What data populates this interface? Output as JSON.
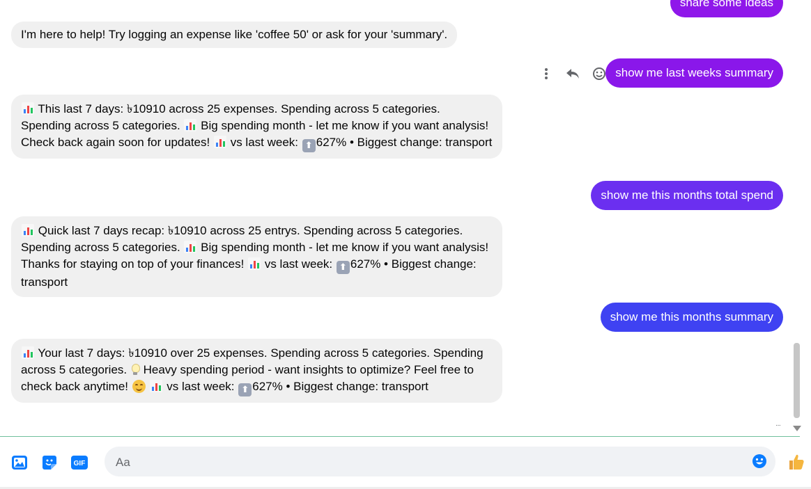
{
  "colors": {
    "bubble_out_1": "#8f17ea",
    "bubble_out_2": "#8a17ea",
    "bubble_out_3": "#6b2ff0",
    "bubble_out_4": "#3f42f2",
    "bubble_in": "#f0f0f0",
    "icon_blue": "#0a7cff"
  },
  "messages": {
    "out_0": "share some ideas",
    "in_0": "I'm here to help! Try logging an expense like 'coffee 50' or ask for your 'summary'.",
    "out_1": "show me last weeks summary",
    "in_1": {
      "a": "This last 7 days: ৳10910 across 25 expenses. Spending across 5 categories. Spending across 5 categories.",
      "b": "Big spending month - let me know if you want analysis! Check back again soon for updates!",
      "c": "vs last week:",
      "d": "627% • Biggest change: transport"
    },
    "out_2": "show me this months total spend",
    "in_2": {
      "a": "Quick last 7 days recap: ৳10910 across 25 entrys. Spending across 5 categories. Spending across 5 categories.",
      "b": "Big spending month - let me know if you want analysis! Thanks for staying on top of your finances!",
      "c": "vs last week:",
      "d": "627% • Biggest change: transport"
    },
    "out_3": "show me this months summary",
    "in_3": {
      "a": "Your last 7 days: ৳10910 over 25 expenses. Spending across 5 categories. Spending across 5 categories.",
      "b": "Heavy spending period - want insights to optimize? Feel free to check back anytime!",
      "c": "vs last week:",
      "d": "627% • Biggest change: transport"
    }
  },
  "icons": {
    "more": "more-vertical-icon",
    "reply": "reply-icon",
    "react": "smiley-icon",
    "photo": "photo-icon",
    "sticker": "sticker-icon",
    "gif": "gif-icon",
    "gif_text": "GIF",
    "emoji": "emoji-icon",
    "like": "thumbs-up-icon",
    "typing": "···"
  },
  "composer": {
    "placeholder": "Aa",
    "value": ""
  }
}
